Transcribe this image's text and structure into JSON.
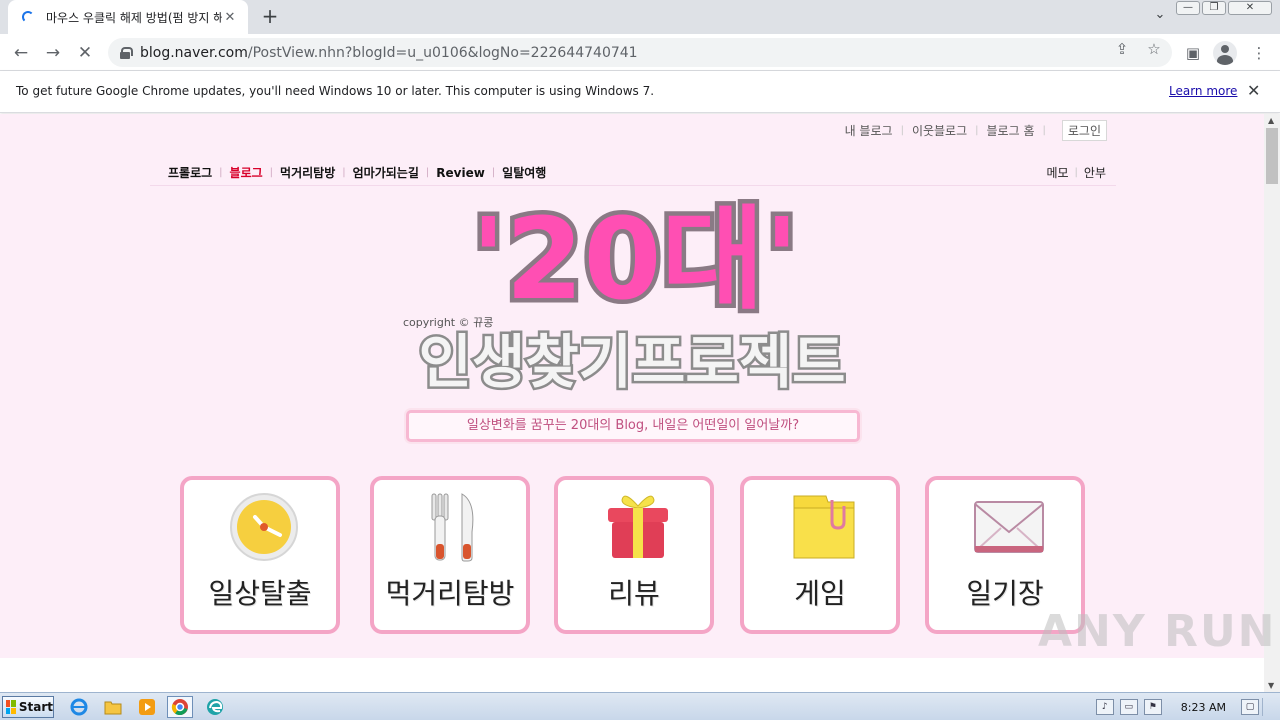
{
  "browser": {
    "tab_title": "마우스 우클릭 해제 방법(펌 방지 해",
    "tab_close": "✕",
    "new_tab": "+",
    "tabs_dropdown": "⌄",
    "window_buttons": {
      "minimize": "—",
      "restore": "❐",
      "close": "✕"
    },
    "nav": {
      "back": "←",
      "forward": "→",
      "reload": "✕"
    },
    "url_host": "blog.naver.com",
    "url_path": "/PostView.nhn?blogId=u_u0106&logNo=222644740741",
    "toolbar_icons": {
      "share": "⇪",
      "bookmark": "☆",
      "sidepanel": "▣",
      "menu": "⋮"
    }
  },
  "infobar": {
    "message": "To get future Google Chrome updates, you'll need Windows 10 or later. This computer is using Windows 7.",
    "link": "Learn more",
    "close": "✕"
  },
  "blog": {
    "util_nav": [
      "내 블로그",
      "이웃블로그",
      "블로그 홈"
    ],
    "login": "로그인",
    "menu": [
      "프롤로그",
      "블로그",
      "먹거리탐방",
      "엄마가되는길",
      "Review",
      "일탈여행"
    ],
    "menu_active_index": 1,
    "menu_right": [
      "메모",
      "안부"
    ],
    "banner_title": "'20대'",
    "banner_subtitle": "인생찾기프로젝트",
    "banner_copyright": "copyright © 뀨콩",
    "slogan": "일상변화를 꿈꾸는 20대의 Blog, 내일은 어떤일이 일어날까?",
    "categories": [
      {
        "label": "일상탈출",
        "icon": "clock-icon"
      },
      {
        "label": "먹거리탐방",
        "icon": "fork-knife-icon"
      },
      {
        "label": "리뷰",
        "icon": "gift-icon"
      },
      {
        "label": "게임",
        "icon": "folder-clip-icon"
      },
      {
        "label": "일기장",
        "icon": "envelope-icon"
      }
    ],
    "colors": {
      "page_bg": "#fdeef8",
      "accent": "#f4a5c6",
      "active_menu": "#d8002a",
      "banner_pink": "#ff4fb3"
    }
  },
  "watermark": "ANY RUN",
  "taskbar": {
    "start": "Start",
    "clock": "8:23 AM"
  }
}
